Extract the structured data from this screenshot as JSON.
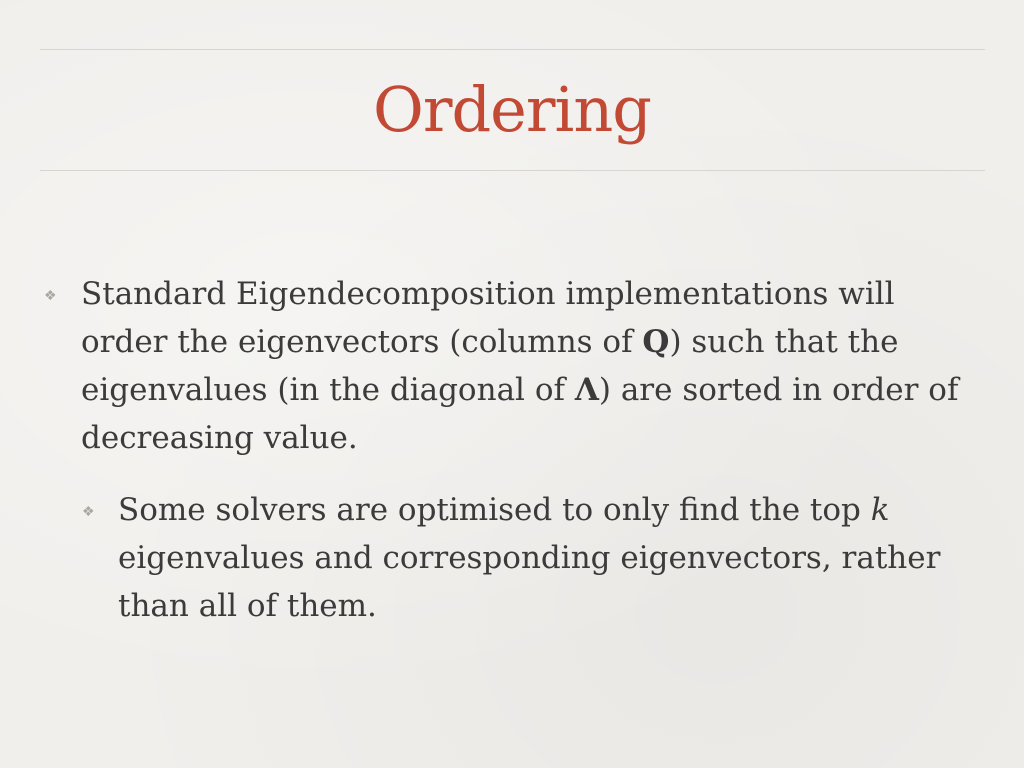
{
  "slide": {
    "title": "Ordering",
    "bullets": [
      {
        "marker": "❖",
        "text_parts": [
          "Standard Eigendecomposition implementations will order the eigenvectors (columns of ",
          "Q",
          ") such that the eigenvalues (in the diagonal of ",
          "Λ",
          ") are sorted in order of decreasing value."
        ]
      },
      {
        "marker": "❖",
        "text_parts": [
          "Some solvers are optimised to only find the top ",
          "k",
          " eigenvalues and corresponding eigenvectors, rather than all of them."
        ]
      }
    ]
  },
  "colors": {
    "title": "#c24a35",
    "text": "#3b3b3b",
    "rule": "#d8d5d1",
    "background": "#f1efec"
  }
}
